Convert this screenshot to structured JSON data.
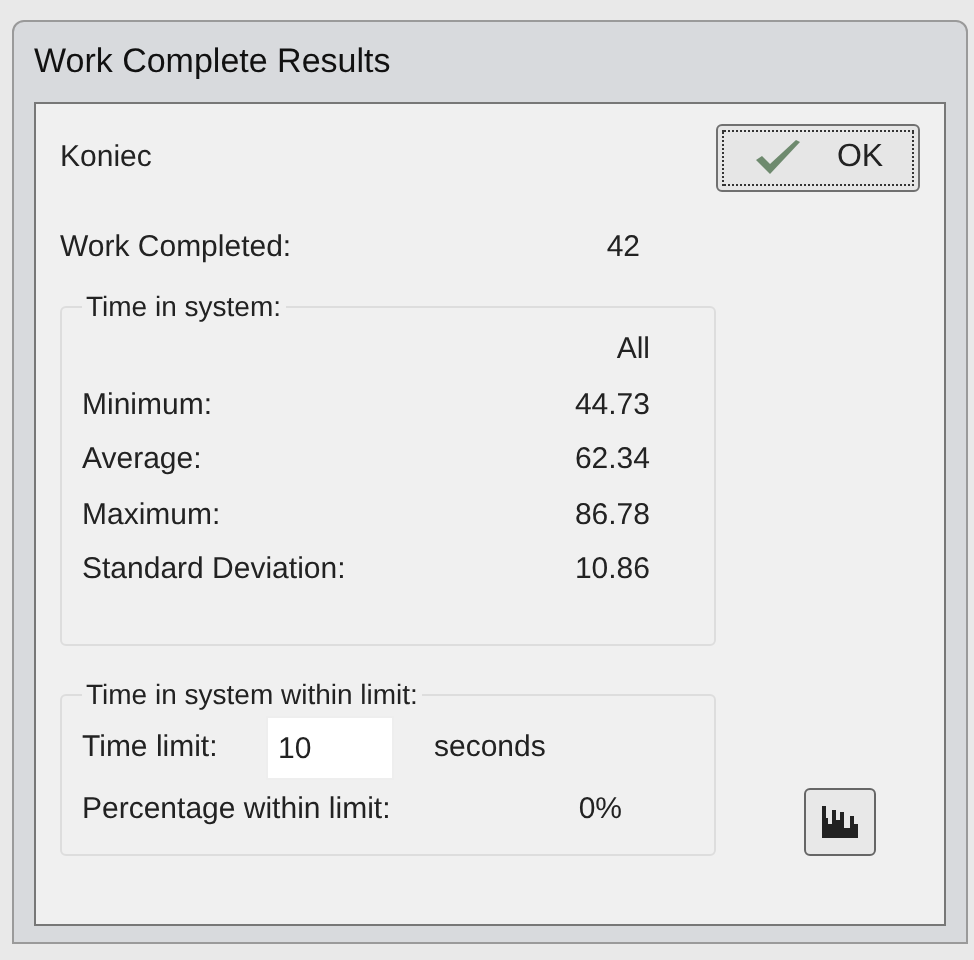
{
  "window": {
    "title": "Work Complete Results"
  },
  "header": "Koniec",
  "ok_button": {
    "label": "OK"
  },
  "work_completed": {
    "label": "Work Completed:",
    "value": "42"
  },
  "time_in_system": {
    "legend": "Time in system:",
    "column": "All",
    "rows": [
      {
        "label": "Minimum:",
        "value": "44.73"
      },
      {
        "label": "Average:",
        "value": "62.34"
      },
      {
        "label": "Maximum:",
        "value": "86.78"
      },
      {
        "label": "Standard Deviation:",
        "value": "10.86"
      }
    ]
  },
  "within_limit": {
    "legend": "Time in system within limit:",
    "time_limit_label": "Time limit:",
    "time_limit_value": "10",
    "unit": "seconds",
    "percentage_label": "Percentage within limit:",
    "percentage_value": "0%"
  }
}
